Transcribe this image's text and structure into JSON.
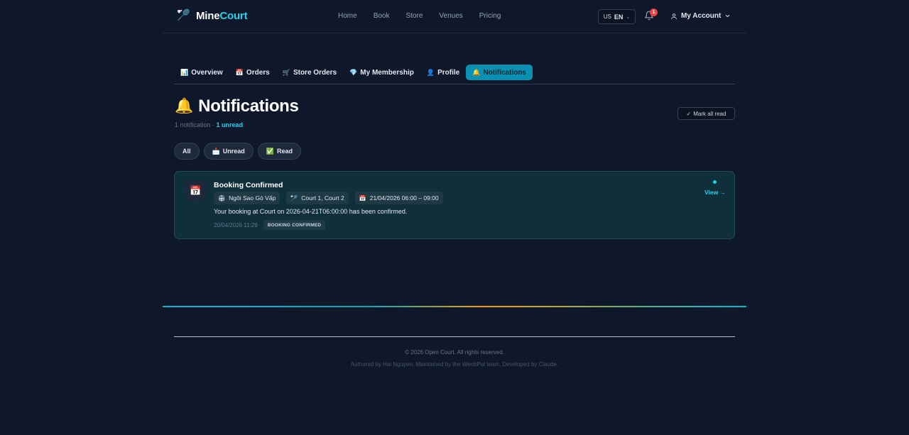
{
  "header": {
    "logo_prefix": "Mine",
    "logo_suffix": "Court",
    "nav": [
      "Home",
      "Book",
      "Store",
      "Venues",
      "Pricing"
    ],
    "lang_flag": "US",
    "lang_code": "EN",
    "notif_count": "1",
    "account_label": "My Account"
  },
  "tabs": [
    {
      "icon": "📊",
      "label": "Overview"
    },
    {
      "icon": "📅",
      "label": "Orders"
    },
    {
      "icon": "🛒",
      "label": "Store Orders"
    },
    {
      "icon": "💎",
      "label": "My Membership"
    },
    {
      "icon": "👤",
      "label": "Profile"
    },
    {
      "icon": "🔔",
      "label": "Notifications"
    }
  ],
  "page": {
    "title": "Notifications",
    "count_text": "1 notification · ",
    "unread_text": "1 unread",
    "mark_all_label": "Mark all read"
  },
  "filters": [
    {
      "icon": "",
      "label": "All"
    },
    {
      "icon": "📩",
      "label": "Unread"
    },
    {
      "icon": "✅",
      "label": "Read"
    }
  ],
  "notification": {
    "title": "Booking Confirmed",
    "venue": "Ngôi Sao Gò Vấp",
    "courts": "Court 1, Court 2",
    "datetime": "21/04/2026 06:00 – 09:00",
    "message": "Your booking at Court on 2026-04-21T06:00:00 has been confirmed.",
    "timestamp": "20/04/2026 11:29",
    "type": "BOOKING CONFIRMED",
    "view_label": "View →"
  },
  "footer": {
    "copyright": "© 2026 Open Court. All rights reserved.",
    "credits": "Authored by Hai Nguyen, Maintained by the WeebPal team, Developed by Claude."
  },
  "colors": {
    "background": "#0f172a",
    "accent": "#22d3ee",
    "active_tab": "#0891b2",
    "badge": "#ef4444",
    "card_bg": "#0f2f3a"
  }
}
